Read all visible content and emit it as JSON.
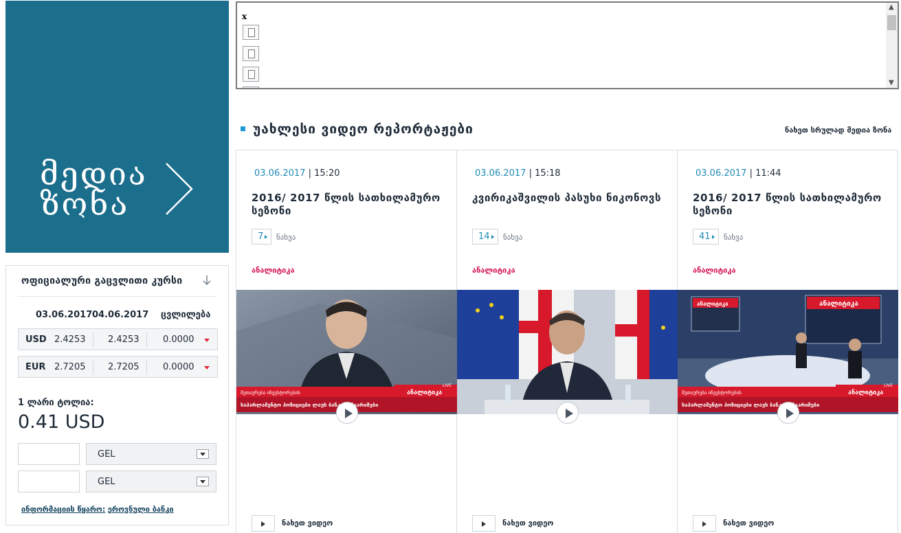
{
  "media_zone": {
    "line1": "მედია",
    "line2": "ზონა"
  },
  "rates": {
    "title": "ოფიციალური გაცვლითი კურსი",
    "date1": "03.06.2017",
    "date2": "04.06.2017",
    "change_label": "ცვლილება",
    "rows": [
      {
        "currency": "USD",
        "v1": "2.4253",
        "v2": "2.4253",
        "change": "0.0000"
      },
      {
        "currency": "EUR",
        "v1": "2.7205",
        "v2": "2.7205",
        "change": "0.0000"
      }
    ],
    "one_lari_label": "1 ლარი ტოლია:",
    "one_lari_value": "0.41 USD",
    "converter": {
      "from_value": "",
      "from_currency": "GEL",
      "to_value": "",
      "to_currency": "GEL"
    },
    "source_label": "ინფორმაციის წყარო:",
    "source_link": "ეროვნული ბანკი"
  },
  "frame": {
    "x_text": "x"
  },
  "section": {
    "title": "უახლესი ვიდეო რეპორტაჟები",
    "view_all": "ნახეთ სრულად მედია ზონა"
  },
  "cards": [
    {
      "date": "03.06.2017",
      "time": "15:20",
      "title": "2016/ 2017 წლის სათხილამურო სეზონი",
      "views": "7",
      "views_label": "ნახვა",
      "category": "ანალიტიკა",
      "watch_label": "ნახეთ ვიდეო"
    },
    {
      "date": "03.06.2017",
      "time": "15:18",
      "title": "კვირიკაშვილის პასუხი ნიკონოვს",
      "views": "14",
      "views_label": "ნახვა",
      "category": "ანალიტიკა",
      "watch_label": "ნახეთ ვიდეო"
    },
    {
      "date": "03.06.2017",
      "time": "11:44",
      "title": "2016/ 2017 წლის სათხილამურო სეზონი",
      "views": "41",
      "views_label": "ნახვა",
      "category": "ანალიტიკა",
      "watch_label": "ნახეთ ვიდეო"
    }
  ],
  "thumb_captions": {
    "tag_left": "მეთაურება ინვესტორების",
    "tag_right": "ანალიტიკა",
    "ticker": "საპარლამენტო პოზიციები ლაუს ბანკის ანგარიშები",
    "live": "LIVE"
  },
  "colors": {
    "media_zone_bg": "#1b6e8c",
    "accent_blue": "#1f8bb5",
    "category_pink": "#d4145a",
    "change_down_red": "#e0283c"
  }
}
